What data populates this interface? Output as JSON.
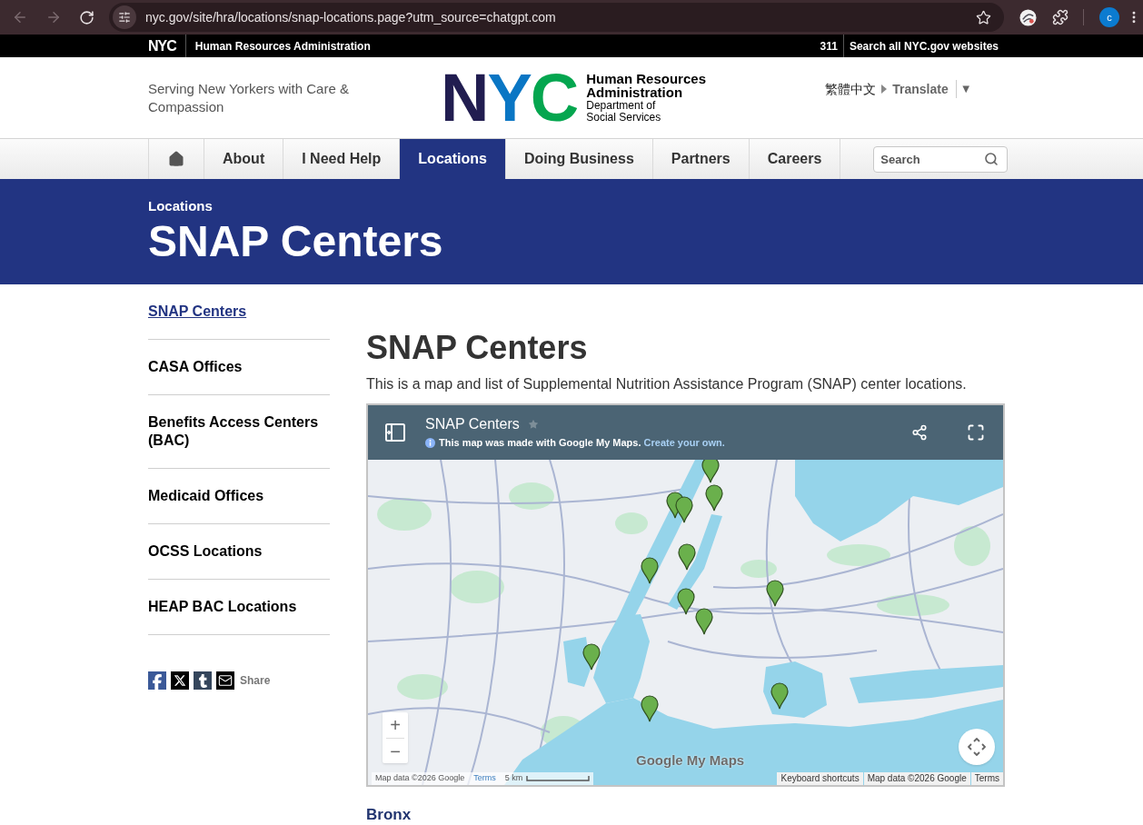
{
  "browser": {
    "url": "nyc.gov/site/hra/locations/snap-locations.page?utm_source=chatgpt.com",
    "profile_initial": "c"
  },
  "top_bar": {
    "logo": "NYC",
    "agency": "Human Resources Administration",
    "links": [
      "311",
      "Search all NYC.gov websites"
    ]
  },
  "header": {
    "tagline": "Serving New Yorkers with Care & Compassion",
    "logo": {
      "mark": "NYC",
      "title": "Human Resources Administration",
      "subtitle": "Department of Social Services"
    },
    "language": "繁體中文",
    "translate": "Translate",
    "translate_menu": "▼"
  },
  "nav": {
    "items": [
      {
        "kind": "home",
        "selected": false
      },
      {
        "kind": "link",
        "label": "About",
        "selected": false
      },
      {
        "kind": "link",
        "label": "I Need Help",
        "selected": false
      },
      {
        "kind": "link",
        "label": "Locations",
        "selected": true
      },
      {
        "kind": "link",
        "label": "Doing Business",
        "selected": false
      },
      {
        "kind": "link",
        "label": "Partners",
        "selected": false
      },
      {
        "kind": "link",
        "label": "Careers",
        "selected": false
      }
    ],
    "search": {
      "placeholder": "Search"
    }
  },
  "banner": {
    "breadcrumb": "Locations",
    "title": "SNAP Centers"
  },
  "sidebar": {
    "items": [
      {
        "label": "SNAP Centers",
        "selected": true
      },
      {
        "label": "CASA Offices",
        "selected": false
      },
      {
        "label": "Benefits Access Centers (BAC)",
        "selected": false
      },
      {
        "label": "Medicaid Offices",
        "selected": false
      },
      {
        "label": "OCSS Locations",
        "selected": false
      },
      {
        "label": "HEAP BAC Locations",
        "selected": false
      }
    ],
    "share": {
      "label": "Share"
    }
  },
  "main": {
    "title": "SNAP Centers",
    "intro": "This is a map and list of Supplemental Nutrition Assistance Program (SNAP) center locations.",
    "map": {
      "title": "SNAP Centers",
      "notice": "This map was made with Google My Maps.",
      "notice_link": "Create your own.",
      "zoom_in": "+",
      "zoom_out": "−",
      "brand": "Google My Maps",
      "attribution_left": {
        "data": "Map data ©2026 Google",
        "terms": "Terms",
        "scale": "5 km"
      },
      "attribution_right": [
        "Keyboard shortcuts",
        "Map data ©2026 Google",
        "Terms"
      ]
    },
    "sections": [
      {
        "title": "Bronx"
      }
    ]
  }
}
